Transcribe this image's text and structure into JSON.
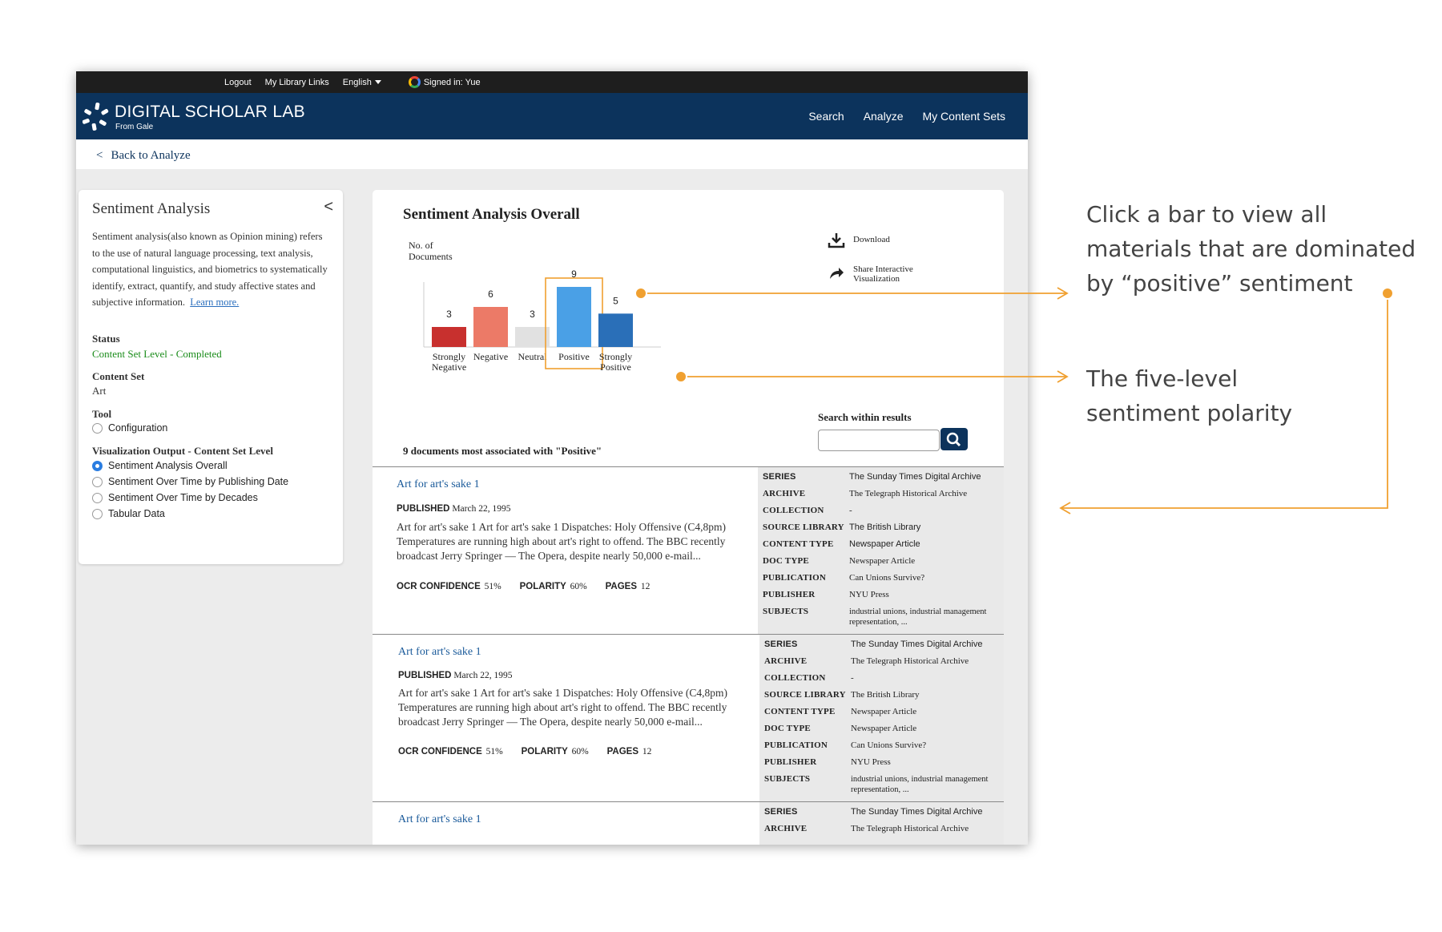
{
  "topbar": {
    "logout": "Logout",
    "library_links": "My Library Links",
    "language": "English",
    "signed_in": "Signed in: Yue"
  },
  "header": {
    "title": "DIGITAL SCHOLAR LAB",
    "subtitle": "From Gale",
    "nav": [
      "Search",
      "Analyze",
      "My Content Sets"
    ]
  },
  "back_link": "Back to Analyze",
  "left_panel": {
    "title": "Sentiment Analysis",
    "description": "Sentiment analysis(also known as Opinion mining) refers to the use of natural language processing, text analysis, computational linguistics, and biometrics to systematically identify, extract, quantify, and study affective states and subjective information.",
    "learn_more": "Learn more.",
    "status_label": "Status",
    "status_value": "Content Set Level - Completed",
    "content_set_label": "Content Set",
    "content_set_value": "Art",
    "tool_label": "Tool",
    "tool_option": "Configuration",
    "viz_label": "Visualization Output - Content Set Level",
    "viz_options": [
      "Sentiment Analysis Overall",
      "Sentiment Over Time by Publishing Date",
      "Sentiment Over Time by Decades",
      "Tabular Data"
    ],
    "viz_selected": 0
  },
  "main": {
    "title": "Sentiment Analysis Overall",
    "download": "Download",
    "share_line1": "Share Interactive",
    "share_line2": "Visualization",
    "search_label": "Search within results",
    "results_count": "9 documents most associated with \"Positive\""
  },
  "chart_data": {
    "type": "bar",
    "ylabel": "No. of Documents",
    "categories": [
      "Strongly Negative",
      "Negative",
      "Neutral",
      "Positive",
      "Strongly Positive"
    ],
    "values": [
      3,
      6,
      3,
      9,
      5
    ],
    "colors": [
      "#c8302e",
      "#ec7a67",
      "#e1e1e1",
      "#4aa0e6",
      "#2a6fb8"
    ],
    "highlighted": "Positive"
  },
  "results": [
    {
      "title": "Art for art's sake 1",
      "published_label": "PUBLISHED",
      "published": "March 22, 1995",
      "snippet": "Art for art's sake 1 Art for art's sake 1 Dispatches: Holy Offensive (C4,8pm) Temperatures are running high about art's right to offend. The BBC recently broadcast Jerry Springer — The Opera, despite nearly 50,000 e-mail...",
      "ocr_label": "OCR CONFIDENCE",
      "ocr": "51%",
      "polarity_label": "POLARITY",
      "polarity": "60%",
      "pages_label": "PAGES",
      "pages": "12",
      "meta": [
        {
          "k": "SERIES",
          "v": "The Sunday Times Digital Archive"
        },
        {
          "k": "ARCHIVE",
          "v": "The Telegraph Historical Archive"
        },
        {
          "k": "COLLECTION",
          "v": "-"
        },
        {
          "k": "SOURCE LIBRARY",
          "v": "The British Library"
        },
        {
          "k": "CONTENT TYPE",
          "v": "Newspaper Article"
        },
        {
          "k": "DOC TYPE",
          "v": "Newspaper Article"
        },
        {
          "k": "PUBLICATION",
          "v": "Can Unions Survive?"
        },
        {
          "k": "PUBLISHER",
          "v": "NYU Press"
        },
        {
          "k": "SUBJECTS",
          "v": "industrial unions, industrial management representation, ..."
        }
      ]
    },
    {
      "title": "Art for art's sake 1",
      "published_label": "PUBLISHED",
      "published": "March 22, 1995",
      "snippet": "Art for art's sake 1 Art for art's sake 1 Dispatches: Holy Offensive (C4,8pm) Temperatures are running high about art's right to offend. The BBC recently broadcast Jerry Springer — The Opera, despite nearly 50,000 e-mail...",
      "ocr_label": "OCR CONFIDENCE",
      "ocr": "51%",
      "polarity_label": "POLARITY",
      "polarity": "60%",
      "pages_label": "PAGES",
      "pages": "12",
      "meta": [
        {
          "k": "SERIES",
          "v": "The Sunday Times Digital Archive"
        },
        {
          "k": "ARCHIVE",
          "v": "The Telegraph Historical Archive"
        },
        {
          "k": "COLLECTION",
          "v": "-"
        },
        {
          "k": "SOURCE LIBRARY",
          "v": "The British Library"
        },
        {
          "k": "CONTENT TYPE",
          "v": "Newspaper Article"
        },
        {
          "k": "DOC TYPE",
          "v": "Newspaper Article"
        },
        {
          "k": "PUBLICATION",
          "v": "Can Unions Survive?"
        },
        {
          "k": "PUBLISHER",
          "v": "NYU Press"
        },
        {
          "k": "SUBJECTS",
          "v": "industrial unions, industrial management representation, ..."
        }
      ]
    },
    {
      "title": "Art for art's sake 1",
      "meta": [
        {
          "k": "SERIES",
          "v": "The Sunday Times Digital Archive"
        },
        {
          "k": "ARCHIVE",
          "v": "The Telegraph Historical Archive"
        }
      ]
    }
  ],
  "annotations": {
    "click_bar_line1": "Click a bar to view all",
    "click_bar_line2": "materials that are dominated",
    "click_bar_line3": "by “positive” sentiment",
    "polarity_line1": "The five-level",
    "polarity_line2": "sentiment polarity",
    "accent_color": "#f0a030"
  }
}
